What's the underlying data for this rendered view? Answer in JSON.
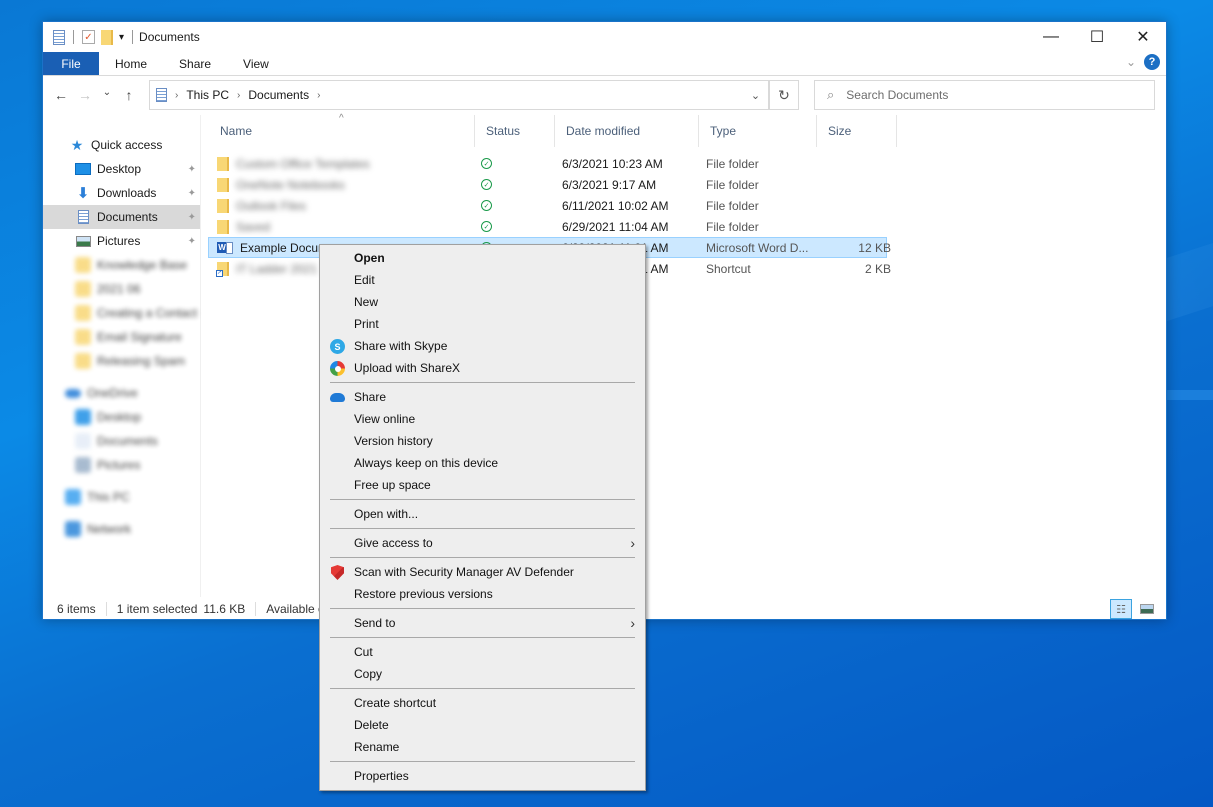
{
  "window": {
    "title": "Documents",
    "controls": {
      "minimize": "—",
      "maximize": "☐",
      "close": "✕"
    }
  },
  "ribbon": {
    "tabs": [
      {
        "label": "File"
      },
      {
        "label": "Home"
      },
      {
        "label": "Share"
      },
      {
        "label": "View"
      }
    ],
    "expand_icon": "⌄",
    "help": "?"
  },
  "navigation": {
    "back": "←",
    "forward": "→",
    "recent": "⌄",
    "up": "↑",
    "breadcrumb": [
      {
        "label": "This PC"
      },
      {
        "label": "Documents"
      }
    ],
    "breadcrumb_sep": "›",
    "dropdown": "⌄",
    "refresh": "↻",
    "search_placeholder": "Search Documents"
  },
  "sidebar": {
    "quick_access": "Quick access",
    "items": [
      {
        "label": "Desktop",
        "pinned": true
      },
      {
        "label": "Downloads",
        "pinned": true
      },
      {
        "label": "Documents",
        "pinned": true,
        "selected": true
      },
      {
        "label": "Pictures",
        "pinned": true
      }
    ],
    "blurred_items": [
      {
        "label": "Knowledge Base",
        "type": "folder"
      },
      {
        "label": "2021 06",
        "type": "folder"
      },
      {
        "label": "Creating a Contact",
        "type": "folder"
      },
      {
        "label": "Email Signature",
        "type": "folder"
      },
      {
        "label": "Releasing Spam",
        "type": "folder"
      },
      {
        "label": "OneDrive",
        "type": "cloud"
      },
      {
        "label": "Desktop",
        "type": "desktop"
      },
      {
        "label": "Documents",
        "type": "doc"
      },
      {
        "label": "Pictures",
        "type": "pic"
      },
      {
        "label": "This PC",
        "type": "pc"
      },
      {
        "label": "Network",
        "type": "net"
      }
    ],
    "pin_glyph": "📌"
  },
  "file_list": {
    "columns": [
      "Name",
      "Status",
      "Date modified",
      "Type",
      "Size"
    ],
    "sort_indicator": "^",
    "rows": [
      {
        "name": "Custom Office Templates",
        "blurred": true,
        "icon": "folder",
        "status": "synced",
        "date": "6/3/2021 10:23 AM",
        "type": "File folder",
        "size": ""
      },
      {
        "name": "OneNote Notebooks",
        "blurred": true,
        "icon": "folder",
        "status": "synced",
        "date": "6/3/2021 9:17 AM",
        "type": "File folder",
        "size": ""
      },
      {
        "name": "Outlook Files",
        "blurred": true,
        "icon": "folder",
        "status": "synced",
        "date": "6/11/2021 10:02 AM",
        "type": "File folder",
        "size": ""
      },
      {
        "name": "Saved",
        "blurred": true,
        "icon": "folder",
        "status": "synced",
        "date": "6/29/2021 11:04 AM",
        "type": "File folder",
        "size": ""
      },
      {
        "name": "Example Document",
        "blurred": false,
        "icon": "word",
        "status": "synced",
        "date": "6/29/2021 11:01 AM",
        "type": "Microsoft Word D...",
        "size": "12 KB",
        "selected": true
      },
      {
        "name": "IT Ladder 2021",
        "blurred": true,
        "icon": "shortcut",
        "status": "",
        "date": "6/29/2021 11:01 AM",
        "type": "Shortcut",
        "size": "2 KB"
      }
    ],
    "status_glyph": "✓"
  },
  "statusbar": {
    "item_count": "6 items",
    "selection": "1 item selected",
    "selection_size": "11.6 KB",
    "availability": "Available on this device"
  },
  "context_menu": {
    "groups": [
      [
        {
          "label": "Open",
          "bold": true
        },
        {
          "label": "Edit"
        },
        {
          "label": "New"
        },
        {
          "label": "Print"
        },
        {
          "label": "Share with Skype",
          "icon": "skype"
        },
        {
          "label": "Upload with ShareX",
          "icon": "sharex"
        }
      ],
      [
        {
          "label": "Share",
          "icon": "onedrive"
        },
        {
          "label": "View online"
        },
        {
          "label": "Version history"
        },
        {
          "label": "Always keep on this device"
        },
        {
          "label": "Free up space"
        }
      ],
      [
        {
          "label": "Open with..."
        }
      ],
      [
        {
          "label": "Give access to",
          "submenu": true
        }
      ],
      [
        {
          "label": "Scan with Security Manager AV Defender",
          "icon": "shield"
        },
        {
          "label": "Restore previous versions"
        }
      ],
      [
        {
          "label": "Send to",
          "submenu": true
        }
      ],
      [
        {
          "label": "Cut"
        },
        {
          "label": "Copy"
        }
      ],
      [
        {
          "label": "Create shortcut"
        },
        {
          "label": "Delete"
        },
        {
          "label": "Rename"
        }
      ],
      [
        {
          "label": "Properties"
        }
      ]
    ],
    "submenu_arrow": "›"
  }
}
